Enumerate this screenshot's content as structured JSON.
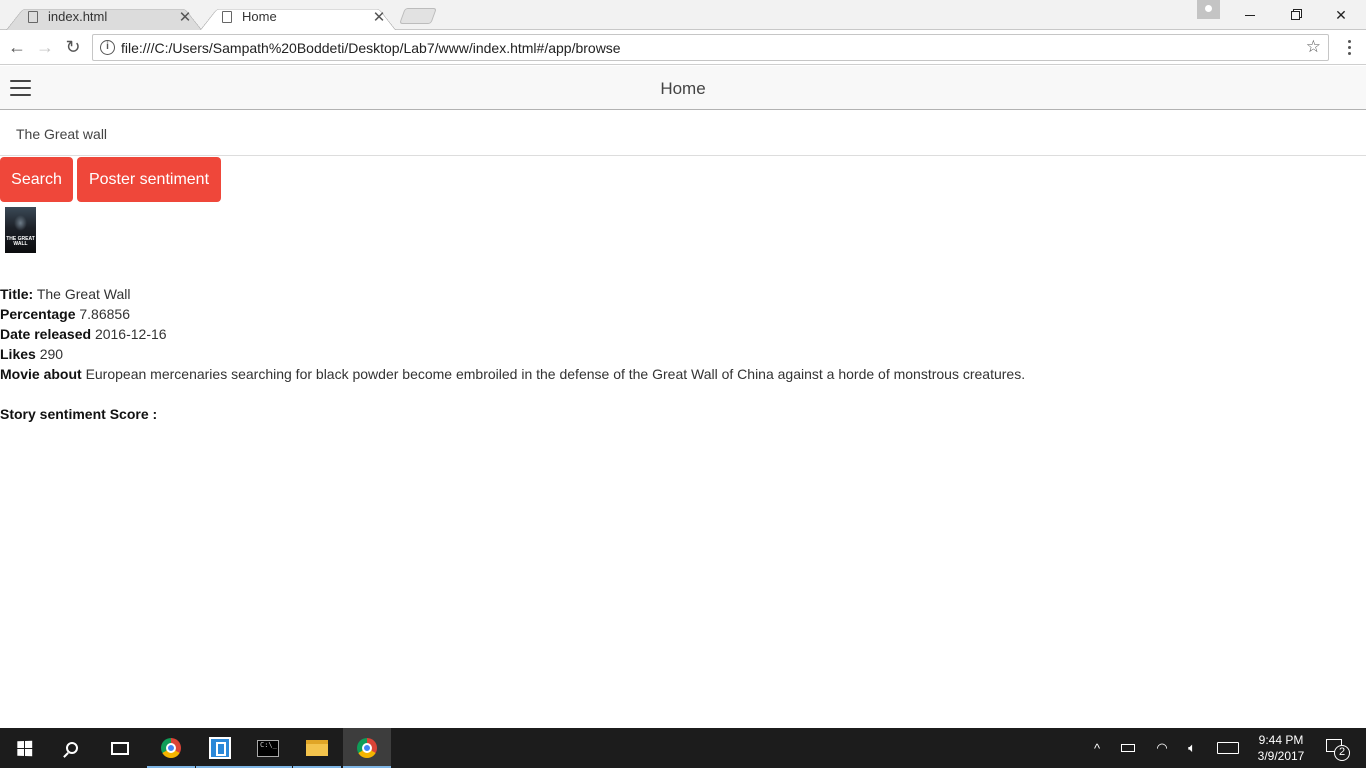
{
  "browser": {
    "tabs": [
      {
        "title": "index.html",
        "active": false
      },
      {
        "title": "Home",
        "active": true
      }
    ],
    "url": "file:///C:/Users/Sampath%20Boddeti/Desktop/Lab7/www/index.html#/app/browse"
  },
  "app": {
    "header_title": "Home",
    "search": {
      "value": "The Great wall"
    },
    "buttons": {
      "search_label": "Search",
      "poster_label": "Poster sentiment"
    },
    "poster": {
      "caption": "THE GREAT WALL"
    },
    "details": {
      "title_label": "Title:",
      "title_value": "The Great Wall",
      "percentage_label": "Percentage",
      "percentage_value": "7.86856",
      "date_label": "Date released",
      "date_value": "2016-12-16",
      "likes_label": "Likes",
      "likes_value": "290",
      "about_label": "Movie about",
      "about_value": "European mercenaries searching for black powder become embroiled in the defense of the Great Wall of China against a horde of monstrous creatures.",
      "sentiment_label": "Story sentiment Score :"
    }
  },
  "taskbar": {
    "clock_time": "9:44 PM",
    "clock_date": "3/9/2017",
    "notification_count": "2"
  },
  "colors": {
    "button_red": "#ef473a",
    "header_bg": "#f8f8f8",
    "taskbar_bg": "#1c1c1c"
  }
}
